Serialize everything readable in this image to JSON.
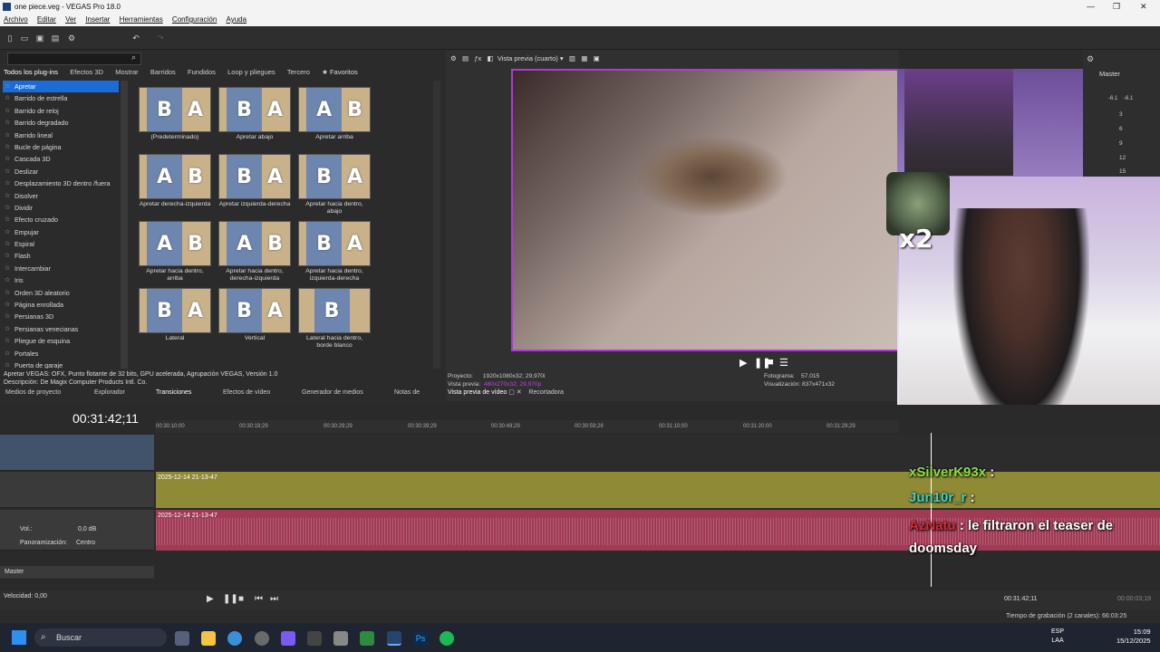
{
  "window": {
    "title": "one piece.veg - VEGAS Pro 18.0",
    "controls": [
      "—",
      "❐",
      "✕"
    ]
  },
  "menu": [
    "Archivo",
    "Editar",
    "Ver",
    "Insertar",
    "Herramientas",
    "Configuración",
    "Ayuda"
  ],
  "fx_tabs": [
    "Todos los plug-ins",
    "Efectos 3D",
    "Mostrar",
    "Barridos",
    "Fundidos",
    "Loop y pliegues",
    "Tercero",
    "★ Favoritos"
  ],
  "transitions": [
    "Apretar",
    "Barrido de estrella",
    "Barrido de reloj",
    "Barrido degradado",
    "Barrido lineal",
    "Bucle de página",
    "Cascada 3D",
    "Deslizar",
    "Desplazamiento 3D dentro /fuera",
    "Disolver",
    "Dividir",
    "Efecto cruzado",
    "Empujar",
    "Espiral",
    "Flash",
    "Intercambiar",
    "Iris",
    "Orden 3D aleatorio",
    "Página enrollada",
    "Persianas 3D",
    "Persianas venecianas",
    "Pliegue de esquina",
    "Portales",
    "Puerta de garaje"
  ],
  "presets": [
    {
      "caption": "(Predeterminado)",
      "a": "B",
      "b": "A"
    },
    {
      "caption": "Apretar abajo",
      "a": "B",
      "b": "A"
    },
    {
      "caption": "Apretar arriba",
      "a": "A",
      "b": "B"
    },
    {
      "caption": "Apretar derecha-izquierda",
      "a": "A",
      "b": "B"
    },
    {
      "caption": "Apretar izquierda-derecha",
      "a": "B",
      "b": "A"
    },
    {
      "caption": "Apretar hacia dentro, abajo",
      "a": "B",
      "b": "A"
    },
    {
      "caption": "Apretar hacia dentro, arriba",
      "a": "A",
      "b": "B"
    },
    {
      "caption": "Apretar hacia dentro, derecha-izquierda",
      "a": "A",
      "b": "B"
    },
    {
      "caption": "Apretar hacia dentro, izquierda-derecha",
      "a": "B",
      "b": "A"
    },
    {
      "caption": "Lateral",
      "a": "B",
      "b": "A"
    },
    {
      "caption": "Vertical",
      "a": "B",
      "b": "A"
    },
    {
      "caption": "Lateral hacia dentro, borde blanco",
      "a": "B",
      "b": ""
    }
  ],
  "description": {
    "line1": "Apretar VEGAS: OFX, Punto flotante de 32 bits, GPU acelerada, Agrupación VEGAS, Versión 1.0",
    "line2": "Descripción: De Magix Computer Products Intl. Co."
  },
  "left_bottom_tabs": [
    "Medios de proyecto",
    "Explorador",
    "Transiciones",
    "Efectos de vídeo",
    "Generador de medios",
    "Notas de"
  ],
  "preview": {
    "mode": "Vista previa (cuarto)",
    "project_label": "Proyecto:",
    "project_value": "1920x1080x32; 29,970i",
    "preview_label": "Vista previa:",
    "preview_value": "480x270x32; 29,970p",
    "frame_label": "Fotograma:",
    "frame_value": "57.015",
    "display_label": "Visualización:",
    "display_value": "837x471x32",
    "tabs": [
      "Vista previa de vídeo",
      "Recortadora"
    ]
  },
  "master": {
    "label": "Master",
    "left": "-6.1",
    "right": "-6.1",
    "ticks": [
      "3",
      "6",
      "9",
      "12",
      "15"
    ]
  },
  "timeline": {
    "timecode": "00:31:42;11",
    "ruler": [
      "00:30:10;00",
      "00:30:19;29",
      "00:30:29;29",
      "00:30:39;29",
      "00:30:49;29",
      "00:30:59;28",
      "00:31:10;00",
      "00:31:20;00",
      "00:31:29;29"
    ],
    "clip_video": "2025-12-14 21-13-47",
    "clip_audio": "2025-12-14 21-13-47",
    "vol_label": "Vol.:",
    "vol_value": "0,0 dB",
    "pan_label": "Panoramización:",
    "pan_value": "Centro",
    "master_label": "Master",
    "speed_label": "Velocidad: 0,00",
    "end_time": "00:31:42;11",
    "end_time2": "00:00:03;19",
    "rec_time": "Tiempo de grabación (2 canales): 66:03:25"
  },
  "overlay": {
    "x2": "x2",
    "chat": [
      {
        "user": "xSilverK93x",
        "text": ":"
      },
      {
        "user": "Jun10r_r",
        "text": ":"
      },
      {
        "user": "AzNatu",
        "text": ": le filtraron el teaser de doomsday"
      }
    ]
  },
  "taskbar": {
    "search": "Buscar",
    "lang1": "ESP",
    "lang2": "LAA",
    "time": "15:09",
    "date": "15/12/2025"
  },
  "colors": {
    "accent": "#1c6bd6",
    "video_track": "#8f8a36",
    "audio_track": "#a03b55",
    "preview_border": "#b238d8"
  }
}
